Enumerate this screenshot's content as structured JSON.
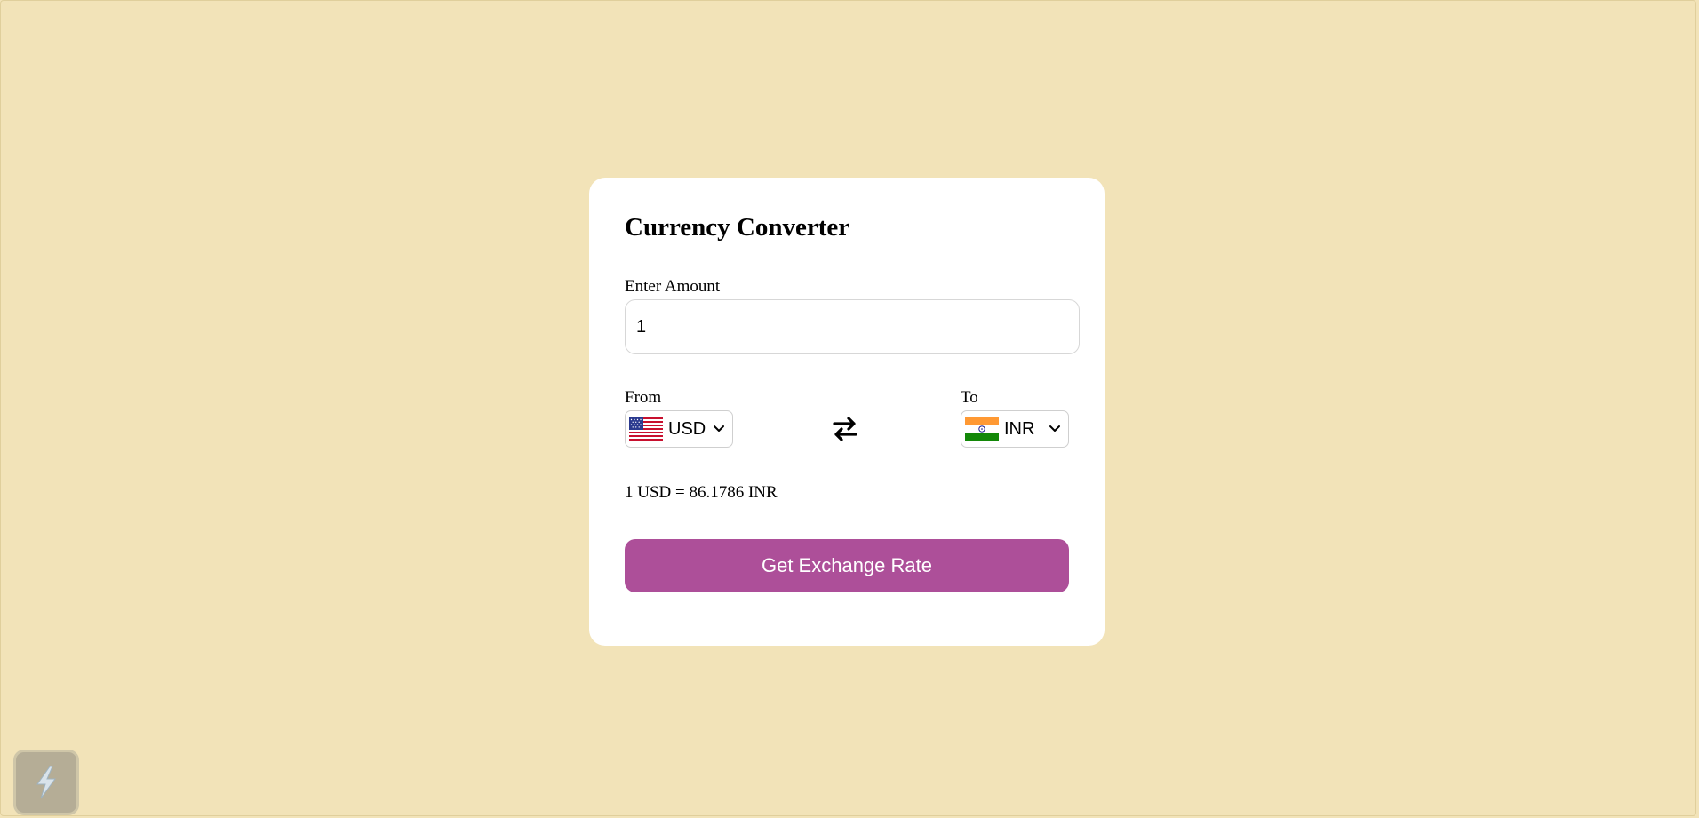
{
  "card": {
    "title": "Currency Converter",
    "amount_label": "Enter Amount",
    "amount_value": "1",
    "from_label": "From",
    "to_label": "To",
    "from_currency": {
      "code": "USD",
      "flag": "us-flag-icon"
    },
    "to_currency": {
      "code": "INR",
      "flag": "india-flag-icon"
    },
    "swap_icon": "swap-arrows-icon",
    "rate_text": "1 USD = 86.1786 INR",
    "button_label": "Get Exchange Rate"
  },
  "widget": {
    "icon": "lightning-bolt-icon"
  },
  "colors": {
    "background": "#f2e3b8",
    "card": "#ffffff",
    "accent": "#ad4f99",
    "button_text": "#ffffff"
  }
}
